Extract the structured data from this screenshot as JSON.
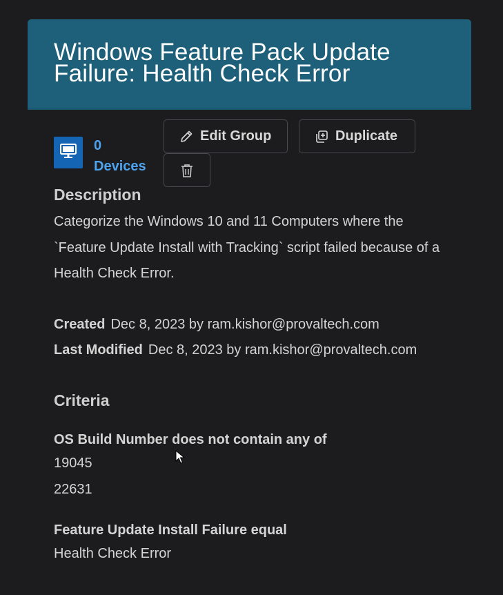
{
  "header": {
    "title": "Windows Feature Pack Update Failure: Health Check Error"
  },
  "devices": {
    "count": "0",
    "label": "Devices",
    "icon": "monitor-icon"
  },
  "actions": {
    "edit_label": "Edit Group",
    "duplicate_label": "Duplicate",
    "delete_icon": "trash-icon"
  },
  "description": {
    "heading": "Description",
    "text": "Categorize the Windows 10 and 11 Computers where the `Feature Update Install with Tracking` script failed because of a Health Check Error."
  },
  "meta": {
    "created_label": "Created",
    "created_value": "Dec 8, 2023 by ram.kishor@provaltech.com",
    "modified_label": "Last Modified",
    "modified_value": "Dec 8, 2023 by ram.kishor@provaltech.com"
  },
  "criteria": {
    "heading": "Criteria",
    "items": [
      {
        "title": "OS Build Number does not contain any of",
        "values": [
          "19045",
          "22631"
        ]
      },
      {
        "title": "Feature Update Install Failure equal",
        "values": [
          "Health Check Error"
        ]
      }
    ]
  },
  "colors": {
    "header_bg": "#1e6079",
    "device_icon_bg": "#1565b5",
    "link": "#4da3ee",
    "page_bg": "#1c1c1e"
  }
}
